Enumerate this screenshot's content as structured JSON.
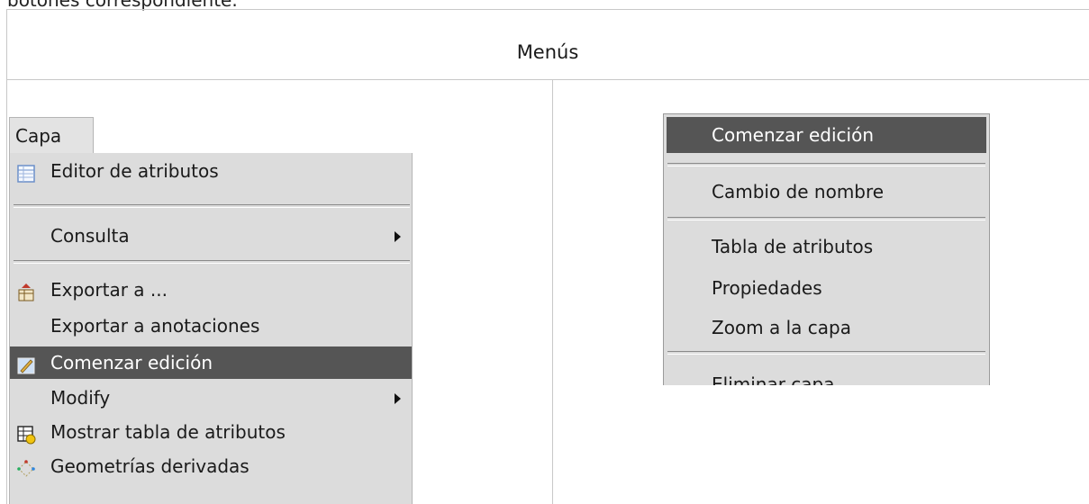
{
  "intro_text": "botones correspondiente.",
  "header": {
    "title": "Menús"
  },
  "left_menu": {
    "menubar_label": "Capa",
    "items": [
      {
        "label": "Editor de atributos",
        "icon": "table-icon",
        "submenu": false
      },
      {
        "label": "Consulta",
        "icon": "",
        "submenu": true
      },
      {
        "label": "Exportar a ...",
        "icon": "export-icon",
        "submenu": false
      },
      {
        "label": "Exportar a anotaciones",
        "icon": "",
        "submenu": false
      },
      {
        "label": "Comenzar edición",
        "icon": "edit-icon",
        "submenu": false,
        "highlighted": true
      },
      {
        "label": "Modify",
        "icon": "",
        "submenu": true
      },
      {
        "label": "Mostrar tabla de atributos",
        "icon": "attribute-table-icon",
        "submenu": false
      },
      {
        "label": "Geometrías derivadas",
        "icon": "derived-geometry-icon",
        "submenu": false
      }
    ]
  },
  "right_menu": {
    "items": [
      {
        "label": "Comenzar edición",
        "highlighted": true
      },
      {
        "label": "Cambio de nombre"
      },
      {
        "label": "Tabla de atributos"
      },
      {
        "label": "Propiedades"
      },
      {
        "label": "Zoom a la capa"
      },
      {
        "label": "Eliminar capa"
      }
    ]
  },
  "colors": {
    "menu_bg": "#dcdcdc",
    "highlight": "#555555",
    "highlight_text": "#ffffff"
  }
}
